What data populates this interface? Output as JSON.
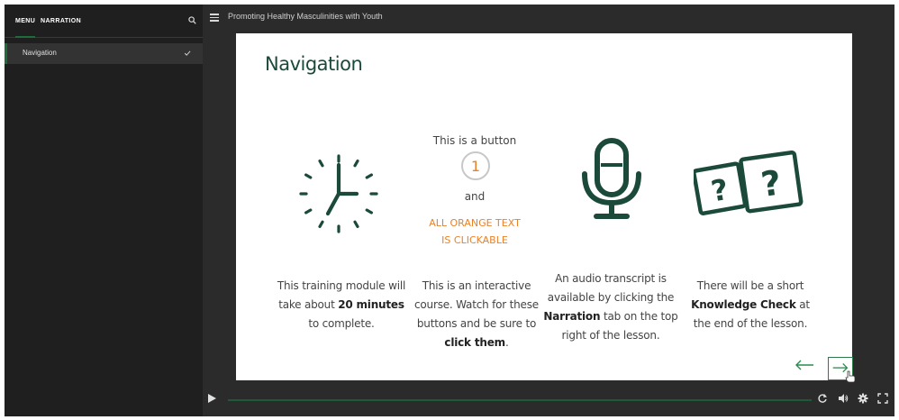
{
  "sidebar": {
    "tabs": [
      "MENU",
      "NARRATION"
    ],
    "items": [
      {
        "label": "Navigation",
        "completed": true
      }
    ]
  },
  "topbar": {
    "course_title": "Promoting Healthy Masculinities with Youth"
  },
  "slide": {
    "title": "Navigation",
    "button_demo": {
      "intro": "This is a button",
      "number": "1",
      "and": "and",
      "orange_line1": "ALL ORANGE TEXT",
      "orange_line2": "IS CLICKABLE"
    },
    "captions": {
      "duration": {
        "pre": "This training module will take about ",
        "bold": "20 minutes",
        "post": " to complete."
      },
      "interactive": {
        "pre": "This is an interactive course. Watch for these buttons and be sure to ",
        "bold": "click them",
        "post": "."
      },
      "transcript": {
        "pre": "An audio transcript is available by clicking the ",
        "bold": "Narration",
        "post": " tab on the top right of the lesson."
      },
      "knowledge": {
        "pre": "There will be a short ",
        "bold": "Knowledge Check",
        "post": " at the end of the lesson."
      }
    }
  },
  "colors": {
    "accent_green": "#1e6b3c",
    "icon_green": "#1b4a3a",
    "orange": "#e8822a"
  },
  "icons": {
    "search": "search-icon",
    "check": "check-icon",
    "hamburger": "hamburger-icon",
    "clock": "clock-icon",
    "mic": "microphone-icon",
    "question": "question-cards-icon",
    "prev": "arrow-left-icon",
    "next": "arrow-right-icon",
    "play": "play-icon",
    "replay": "replay-icon",
    "volume": "volume-icon",
    "settings": "gear-icon",
    "fullscreen": "fullscreen-icon"
  }
}
